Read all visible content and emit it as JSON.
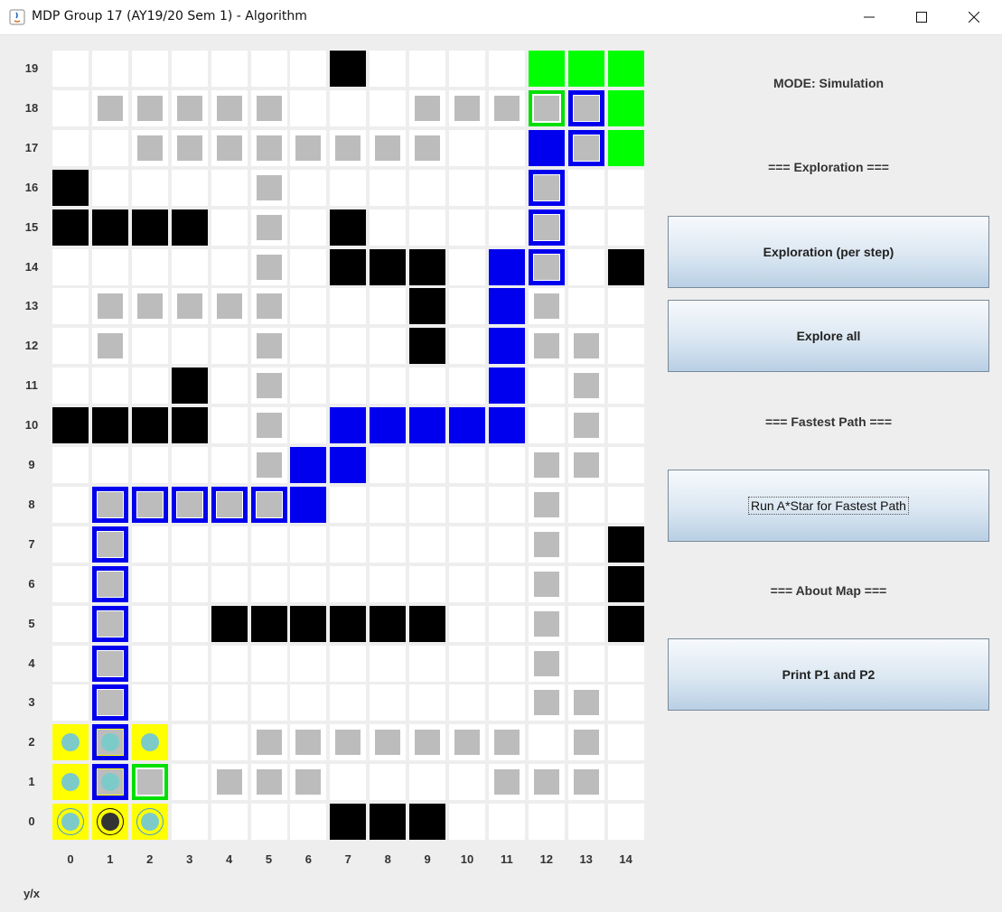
{
  "window": {
    "title": "MDP Group 17 (AY19/20 Sem 1) - Algorithm"
  },
  "colors": {
    "obstacle": "#000000",
    "path": "#0000ee",
    "goal": "#00ff00",
    "start": "#ffff00",
    "explored": "#ffffff",
    "sensor": "#bcbcbc",
    "robot": "#7ccbc8"
  },
  "icons": [
    "java-app-icon",
    "minimize-icon",
    "maximize-icon",
    "close-icon"
  ],
  "grid": {
    "corner_label": "y/x",
    "x_labels": [
      "0",
      "1",
      "2",
      "3",
      "4",
      "5",
      "6",
      "7",
      "8",
      "9",
      "10",
      "11",
      "12",
      "13",
      "14"
    ],
    "y_labels": [
      "19",
      "18",
      "17",
      "16",
      "15",
      "14",
      "13",
      "12",
      "11",
      "10",
      "9",
      "8",
      "7",
      "6",
      "5",
      "4",
      "3",
      "2",
      "1",
      "0"
    ],
    "rows": [
      "_______B____GGG",
      "_SSSSS___SSSsTG",
      "__SSSSSSSS__ETG",
      "B____S______T__",
      "BBBB_S_B____T__",
      "_____S_BBB_PT_B",
      "_SSSSS___B_PS__",
      "_S___S___B_PSS_",
      "___B_S_____P_S_",
      "BBBB_S_PPPPP_S_",
      "_____SPP____SS_",
      "_TTTTTP_____S__",
      "_T__________S_B",
      "_T__________S_B",
      "_T__BBBBBB__S_B",
      "_T__________S__",
      "_T__________SS_",
      "rur__SSSSSSS_S_",
      "rus_SSS____SSS_",
      "rhr____BBB_____"
    ],
    "legend": {
      "_": "explored empty",
      "B": "obstacle",
      "S": "sensed cell",
      "G": "goal zone",
      "s": "goal zone sensed",
      "E": "path cell",
      "P": "fastest path cell",
      "T": "path sensed cell",
      "r": "start zone robot",
      "u": "robot on path",
      "s2": "",
      "h": "robot head"
    }
  },
  "panel": {
    "mode_label": "MODE:",
    "mode_value": "Simulation",
    "exploration_header": "=== Exploration ===",
    "btn_explore_step": "Exploration (per step)",
    "btn_explore_all": "Explore all",
    "fastest_path_header": "=== Fastest Path ===",
    "btn_fastest_path": "Run A*Star for Fastest Path",
    "about_map_header": "=== About Map ===",
    "btn_print_map": "Print P1 and P2"
  }
}
